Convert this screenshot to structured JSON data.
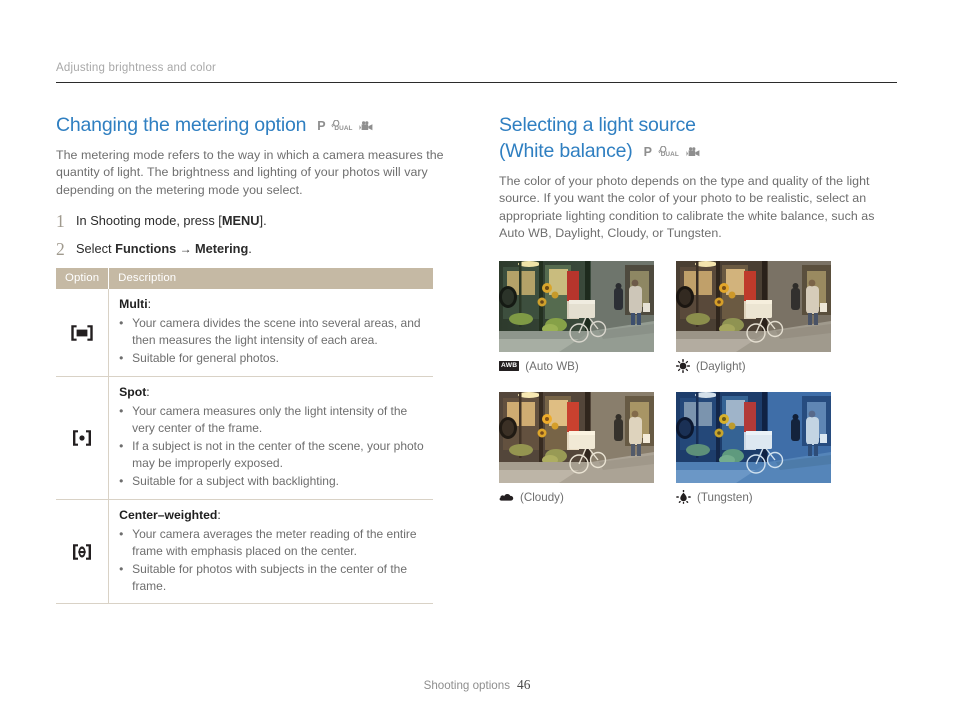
{
  "running_header": "Adjusting brightness and color",
  "mode_icons": {
    "p_label": "P",
    "dual_label": "DUAL",
    "cam_icon": "camcorder-icon"
  },
  "colors": {
    "heading_blue": "#2f7fc1",
    "table_header_tan": "#c5b9a4",
    "body_gray": "#6e6e6e",
    "rule_dark": "#2b2b2b",
    "step_number": "#a09a8e"
  },
  "left": {
    "heading": "Changing the metering option",
    "intro": "The metering mode refers to the way in which a camera measures the quantity of light. The brightness and lighting of your photos will vary depending on the metering mode you select.",
    "steps": [
      {
        "num": "1",
        "pre": "In Shooting mode, press [",
        "bold": "MENU",
        "post": "]."
      },
      {
        "num": "2",
        "pre": "Select ",
        "bold": "Functions",
        "arrow": "→",
        "bold2": "Metering",
        "post": "."
      }
    ],
    "table": {
      "headers": [
        "Option",
        "Description"
      ],
      "rows": [
        {
          "icon": "metering-multi-icon",
          "title": "Multi",
          "colon": ":",
          "bullets": [
            "Your camera divides the scene into several areas, and then measures the light intensity of each area.",
            "Suitable for general photos."
          ]
        },
        {
          "icon": "metering-spot-icon",
          "title": "Spot",
          "colon": ":",
          "bullets": [
            "Your camera measures only the light intensity of the very center of the frame.",
            "If a subject is not in the center of the scene, your photo may be improperly exposed.",
            "Suitable for a subject with backlighting."
          ]
        },
        {
          "icon": "metering-center-weighted-icon",
          "title": "Center–weighted",
          "colon": ":",
          "bullets": [
            "Your camera averages the meter reading of the entire frame with emphasis placed on the center.",
            "Suitable for photos with subjects in the center of the frame."
          ]
        }
      ]
    }
  },
  "right": {
    "heading_line1": "Selecting a light source",
    "heading_line2": "(White balance)",
    "intro": "The color of your photo depends on the type and quality of the light source. If you want the color of your photo to be realistic, select an appropriate lighting condition to calibrate the white balance, such as Auto WB, Daylight, Cloudy, or Tungsten.",
    "samples": [
      {
        "icon": "auto-wb-icon",
        "icon_text": "AWB",
        "caption": "(Auto WB)",
        "alt": "street-scene-auto-wb"
      },
      {
        "icon": "sun-icon",
        "icon_text": "",
        "caption": "(Daylight)",
        "alt": "street-scene-daylight"
      },
      {
        "icon": "cloud-icon",
        "icon_text": "",
        "caption": "(Cloudy)",
        "alt": "street-scene-cloudy"
      },
      {
        "icon": "bulb-icon",
        "icon_text": "",
        "caption": "(Tungsten)",
        "alt": "street-scene-tungsten"
      }
    ]
  },
  "footer": {
    "label": "Shooting options",
    "page": "46"
  }
}
